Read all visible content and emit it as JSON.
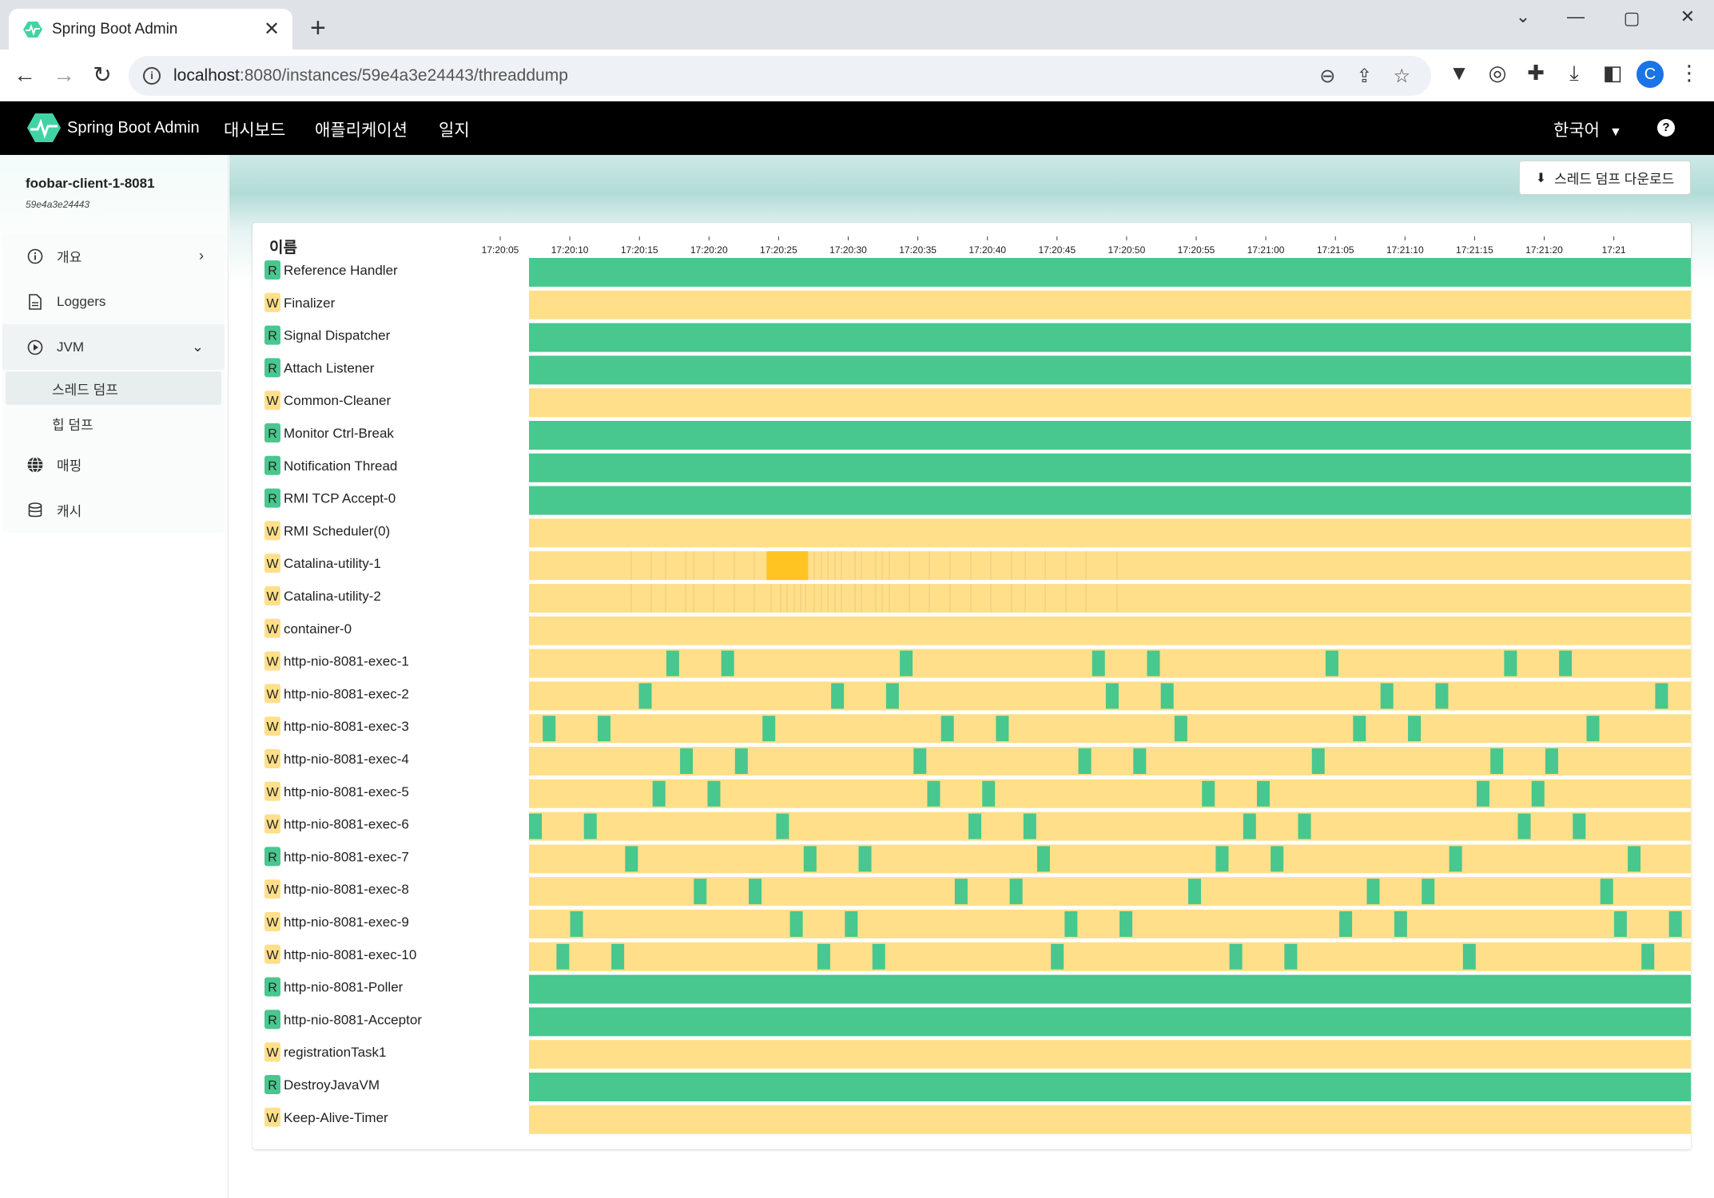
{
  "browser": {
    "tab_title": "Spring Boot Admin",
    "url_host": "localhost",
    "url_rest": ":8080/instances/59e4a3e24443/threaddump",
    "profile_initial": "C"
  },
  "navbar": {
    "brand": "Spring Boot Admin",
    "links": [
      "대시보드",
      "애플리케이션",
      "일지"
    ],
    "language": "한국어",
    "help": "?"
  },
  "sidebar": {
    "instance_name": "foobar-client-1-8081",
    "instance_id": "59e4a3e24443",
    "items": [
      {
        "label": "개요",
        "icon": "info-circle-icon"
      },
      {
        "label": "Loggers",
        "icon": "document-icon"
      },
      {
        "label": "JVM",
        "icon": "play-circle-icon"
      },
      {
        "label": "매핑",
        "icon": "globe-icon"
      },
      {
        "label": "캐시",
        "icon": "database-icon"
      }
    ],
    "jvm_subitems": [
      "스레드 덤프",
      "힙 덤프"
    ]
  },
  "main": {
    "download_button": "스레드 덤프 다운로드",
    "name_header": "이름",
    "time_ticks": [
      "17:20:05",
      "17:20:10",
      "17:20:15",
      "17:20:20",
      "17:20:25",
      "17:20:30",
      "17:20:35",
      "17:20:40",
      "17:20:45",
      "17:20:50",
      "17:20:55",
      "17:21:00",
      "17:21:05",
      "17:21:10",
      "17:21:15",
      "17:21:20",
      "17:21"
    ],
    "colors": {
      "runnable": "#48c78e",
      "waiting": "#ffdf89",
      "timed_waiting_highlight": "#ffc421",
      "grid": "#e6cc80"
    },
    "threads": [
      {
        "state": "R",
        "name": "Reference Handler",
        "timeline": "runnable"
      },
      {
        "state": "W",
        "name": "Finalizer",
        "timeline": "waiting"
      },
      {
        "state": "R",
        "name": "Signal Dispatcher",
        "timeline": "runnable"
      },
      {
        "state": "R",
        "name": "Attach Listener",
        "timeline": "runnable"
      },
      {
        "state": "W",
        "name": "Common-Cleaner",
        "timeline": "waiting"
      },
      {
        "state": "R",
        "name": "Monitor Ctrl-Break",
        "timeline": "runnable"
      },
      {
        "state": "R",
        "name": "Notification Thread",
        "timeline": "runnable"
      },
      {
        "state": "R",
        "name": "RMI TCP Accept-0",
        "timeline": "runnable"
      },
      {
        "state": "W",
        "name": "RMI Scheduler(0)",
        "timeline": "waiting"
      },
      {
        "state": "W",
        "name": "Catalina-utility-1",
        "timeline": "waiting",
        "highlight": [
          17.3,
          17.9
        ]
      },
      {
        "state": "W",
        "name": "Catalina-utility-2",
        "timeline": "waiting"
      },
      {
        "state": "W",
        "name": "container-0",
        "timeline": "waiting"
      },
      {
        "state": "W",
        "name": "http-nio-8081-exec-1",
        "timeline": "waiting",
        "runs": [
          10.0,
          14.0,
          27.0,
          41.0,
          45.0,
          58.0,
          71.0,
          75.0
        ]
      },
      {
        "state": "W",
        "name": "http-nio-8081-exec-2",
        "timeline": "waiting",
        "runs": [
          8.0,
          22.0,
          26.0,
          42.0,
          46.0,
          62.0,
          66.0,
          82.0
        ]
      },
      {
        "state": "W",
        "name": "http-nio-8081-exec-3",
        "timeline": "waiting",
        "runs": [
          1.0,
          5.0,
          17.0,
          30.0,
          34.0,
          47.0,
          60.0,
          64.0,
          77.0
        ]
      },
      {
        "state": "W",
        "name": "http-nio-8081-exec-4",
        "timeline": "waiting",
        "runs": [
          11.0,
          15.0,
          28.0,
          40.0,
          44.0,
          57.0,
          70.0,
          74.0
        ]
      },
      {
        "state": "W",
        "name": "http-nio-8081-exec-5",
        "timeline": "waiting",
        "runs": [
          9.0,
          13.0,
          29.0,
          33.0,
          49.0,
          53.0,
          69.0,
          73.0
        ]
      },
      {
        "state": "W",
        "name": "http-nio-8081-exec-6",
        "timeline": "waiting",
        "runs": [
          0.0,
          4.0,
          18.0,
          32.0,
          36.0,
          52.0,
          56.0,
          72.0,
          76.0
        ]
      },
      {
        "state": "R",
        "name": "http-nio-8081-exec-7",
        "timeline": "waiting",
        "runs": [
          7.0,
          20.0,
          24.0,
          37.0,
          50.0,
          54.0,
          67.0,
          80.0
        ]
      },
      {
        "state": "W",
        "name": "http-nio-8081-exec-8",
        "timeline": "waiting",
        "runs": [
          12.0,
          16.0,
          31.0,
          35.0,
          48.0,
          61.0,
          65.0,
          78.0
        ]
      },
      {
        "state": "W",
        "name": "http-nio-8081-exec-9",
        "timeline": "waiting",
        "runs": [
          3.0,
          19.0,
          23.0,
          39.0,
          43.0,
          59.0,
          63.0,
          79.0,
          83.0
        ]
      },
      {
        "state": "W",
        "name": "http-nio-8081-exec-10",
        "timeline": "waiting",
        "runs": [
          2.0,
          6.0,
          21.0,
          25.0,
          38.0,
          51.0,
          55.0,
          68.0,
          81.0
        ]
      },
      {
        "state": "R",
        "name": "http-nio-8081-Poller",
        "timeline": "runnable"
      },
      {
        "state": "R",
        "name": "http-nio-8081-Acceptor",
        "timeline": "runnable"
      },
      {
        "state": "W",
        "name": "registrationTask1",
        "timeline": "waiting"
      },
      {
        "state": "R",
        "name": "DestroyJavaVM",
        "timeline": "runnable"
      },
      {
        "state": "W",
        "name": "Keep-Alive-Timer",
        "timeline": "waiting"
      }
    ]
  }
}
